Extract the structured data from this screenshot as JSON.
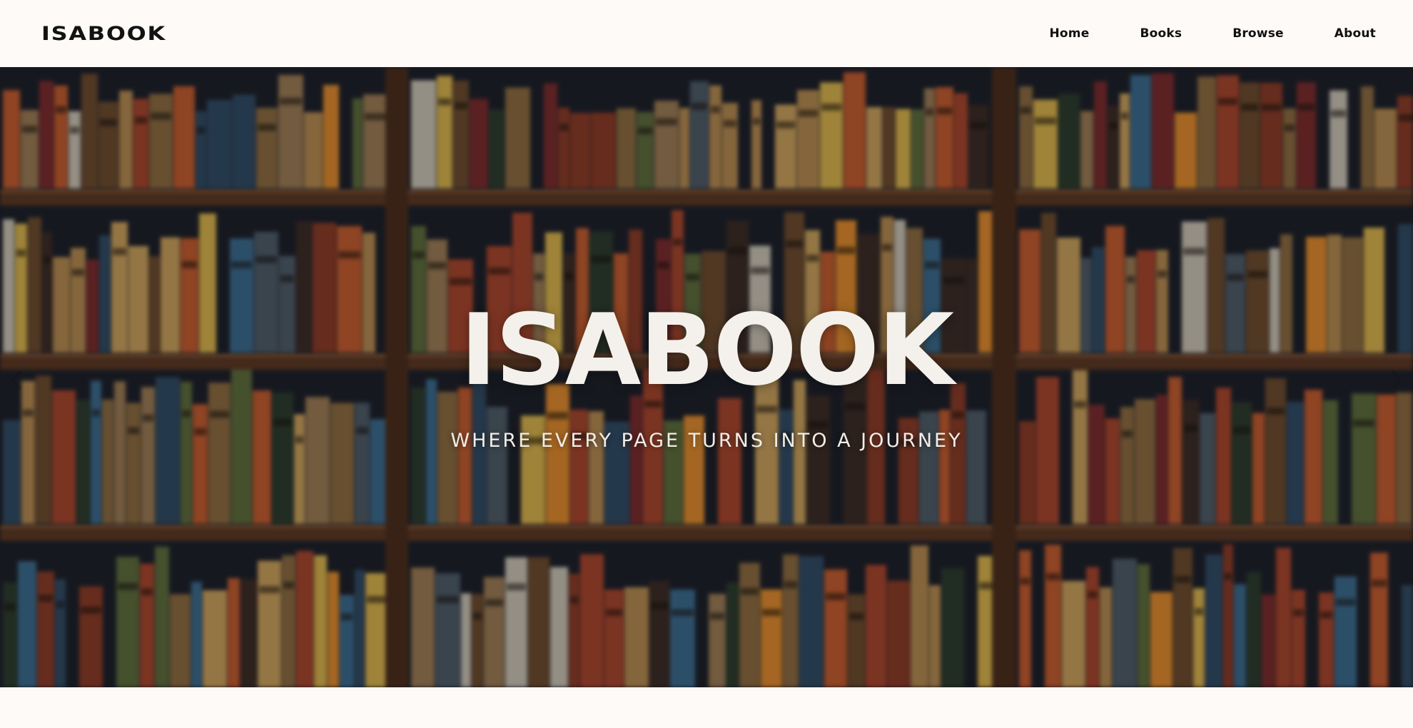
{
  "navbar": {
    "brand": "ISABOOK",
    "links": [
      {
        "label": "Home"
      },
      {
        "label": "Books"
      },
      {
        "label": "Browse"
      },
      {
        "label": "About"
      }
    ]
  },
  "hero": {
    "title": "ISABOOK",
    "tagline": "WHERE EVERY PAGE TURNS INTO A JOURNEY",
    "background": "blurred-bookshelf-photo",
    "prev_icon": "chevron-left-icon",
    "next_icon": "chevron-right-icon"
  },
  "colors": {
    "page_bg": "#fdfaf7",
    "nav_text": "#111111",
    "hero_text": "#f4f1ec",
    "shelf_wood": "#5a3620",
    "shelf_back": "#1a1d26"
  }
}
